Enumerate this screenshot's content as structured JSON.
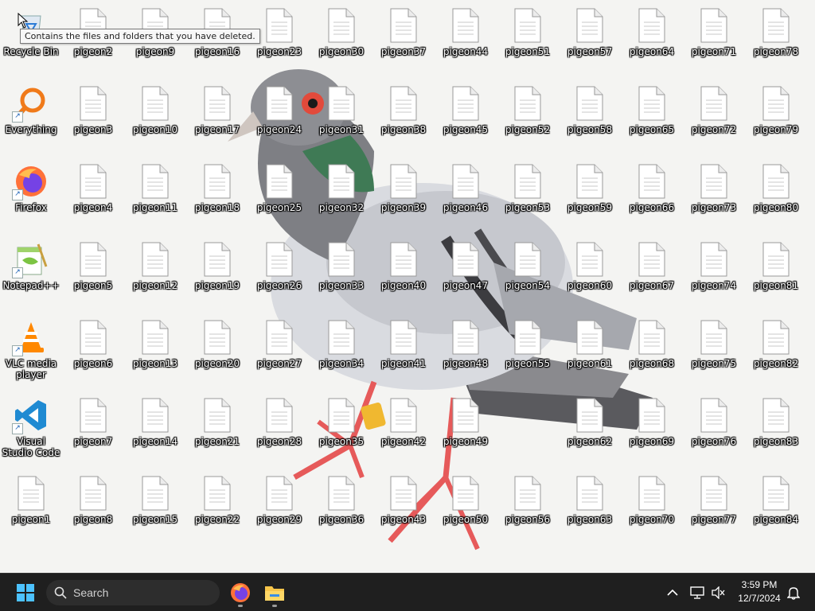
{
  "tooltip": "Contains the files and folders that you have deleted.",
  "app_icons": [
    {
      "label": "Recycle Bin",
      "kind": "recycle-bin"
    },
    {
      "label": "Everything",
      "kind": "everything"
    },
    {
      "label": "Firefox",
      "kind": "firefox"
    },
    {
      "label": "Notepad++",
      "kind": "notepadpp"
    },
    {
      "label": "VLC media player",
      "kind": "vlc"
    },
    {
      "label": "Visual Studio Code",
      "kind": "vscode"
    },
    {
      "label": "pigeon1",
      "kind": "file"
    }
  ],
  "pigeon_files": [
    "pigeon2",
    "pigeon3",
    "pigeon4",
    "pigeon5",
    "pigeon6",
    "pigeon7",
    "pigeon8",
    "pigeon9",
    "pigeon10",
    "pigeon11",
    "pigeon12",
    "pigeon13",
    "pigeon14",
    "pigeon15",
    "pigeon16",
    "pigeon17",
    "pigeon18",
    "pigeon19",
    "pigeon20",
    "pigeon21",
    "pigeon22",
    "pigeon23",
    "pigeon24",
    "pigeon25",
    "pigeon26",
    "pigeon27",
    "pigeon28",
    "pigeon29",
    "pigeon30",
    "pigeon31",
    "pigeon32",
    "pigeon33",
    "pigeon34",
    "pigeon35",
    "pigeon36",
    "pigeon37",
    "pigeon38",
    "pigeon39",
    "pigeon40",
    "pigeon41",
    "pigeon42",
    "pigeon43",
    "pigeon44",
    "pigeon45",
    "pigeon46",
    "pigeon47",
    "pigeon48",
    "pigeon49",
    "pigeon50",
    "pigeon51",
    "pigeon52",
    "pigeon53",
    "pigeon54",
    "pigeon55",
    "pigeon56",
    "pigeon57",
    "pigeon58",
    "pigeon59",
    "pigeon60",
    "pigeon61",
    "pigeon62",
    "pigeon63",
    "pigeon64",
    "pigeon65",
    "pigeon66",
    "pigeon67",
    "pigeon68",
    "pigeon69",
    "pigeon70",
    "pigeon71",
    "pigeon72",
    "pigeon73",
    "pigeon74",
    "pigeon75",
    "pigeon76",
    "pigeon77",
    "pigeon78",
    "pigeon79",
    "pigeon80",
    "pigeon81",
    "pigeon82",
    "pigeon83",
    "pigeon84"
  ],
  "taskbar": {
    "search_placeholder": "Search",
    "time": "3:59 PM",
    "date": "12/7/2024",
    "pinned": [
      "start-icon",
      "search-icon",
      "firefox-icon",
      "file-explorer-icon"
    ],
    "tray": [
      "chevron-up-icon",
      "network-icon",
      "volume-muted-icon",
      "notification-bell-icon"
    ]
  },
  "colors": {
    "taskbar_bg": "#1f1f1f",
    "desktop_bg": "#f4f4f2",
    "icon_label": "#ffffff"
  }
}
